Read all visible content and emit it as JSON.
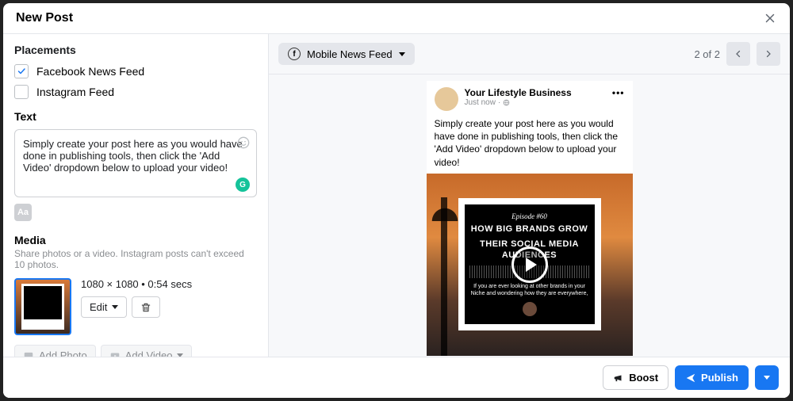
{
  "header": {
    "title": "New Post"
  },
  "placements": {
    "heading": "Placements",
    "options": [
      {
        "label": "Facebook News Feed",
        "checked": true
      },
      {
        "label": "Instagram Feed",
        "checked": false
      }
    ]
  },
  "text": {
    "heading": "Text",
    "value": "Simply create your post here as you would have done in publishing tools, then click the 'Add Video' dropdown below to upload your video!"
  },
  "media": {
    "heading": "Media",
    "subtext": "Share photos or a video. Instagram posts can't exceed 10 photos.",
    "thumb_meta": "1080 × 1080 • 0:54 secs",
    "edit_label": "Edit",
    "add_photo_label": "Add Photo",
    "add_video_label": "Add Video"
  },
  "preview": {
    "selector_label": "Mobile News Feed",
    "pager_text": "2 of 2",
    "author": "Your Lifestyle Business",
    "timestamp": "Just now",
    "body": "Simply create your post here as you would have done in publishing tools, then click the 'Add Video' dropdown below to upload your video!",
    "card": {
      "episode": "Episode #60",
      "line1": "HOW BIG BRANDS GROW",
      "line2": "THEIR SOCIAL MEDIA AUDIENCES",
      "sub": "If you are ever looking at other brands in your Niche and wondering how they are everywhere,"
    }
  },
  "footer": {
    "boost_label": "Boost",
    "publish_label": "Publish"
  }
}
